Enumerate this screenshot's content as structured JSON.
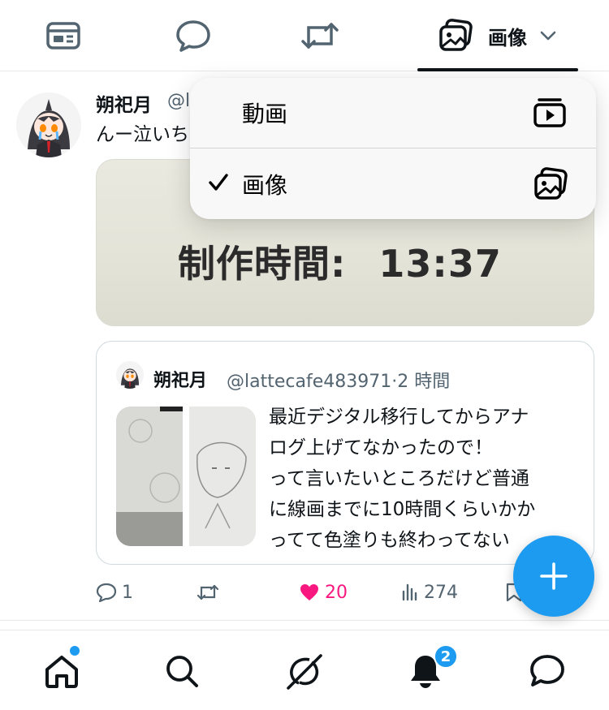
{
  "top_tabs": {
    "tabs": [
      {
        "name": "card-icon",
        "label": ""
      },
      {
        "name": "reply-icon",
        "label": ""
      },
      {
        "name": "repost-icon",
        "label": ""
      },
      {
        "name": "media-icon",
        "label": "画像"
      }
    ],
    "selected_tab_label": "画像"
  },
  "tweet": {
    "author_name": "朔祀月",
    "author_handle": "@l",
    "text": "んー泣いち",
    "media_caption_label": "制作時間:",
    "media_caption_time": "13:37",
    "quote": {
      "author_name": "朔祀月",
      "author_handle": "@lattecafe483971",
      "time_separator": "·",
      "time": "2 時間",
      "text_lines": [
        "最近デジタル移行してからアナ",
        "ログ上げてなかったので！",
        "って言いたいところだけど普通",
        "に線画までに10時間くらいかか",
        "ってて色塗りも終わってない"
      ]
    },
    "actions": {
      "reply_count": "1",
      "repost_count": "",
      "like_count": "20",
      "view_count": "274"
    },
    "colors": {
      "like_active": "#f91880",
      "muted": "#536471"
    }
  },
  "dropdown": {
    "items": [
      {
        "label": "動画",
        "icon": "video-icon",
        "checked": false
      },
      {
        "label": "画像",
        "icon": "image-icon",
        "checked": true
      }
    ],
    "check_mark": "✓"
  },
  "fab": {
    "icon": "plus-icon",
    "color": "#1d9bf0"
  },
  "bottom_nav": {
    "items": [
      "home-icon",
      "search-icon",
      "grok-icon",
      "notifications-icon",
      "messages-icon"
    ],
    "notifications_badge": "2",
    "accent": "#1d9bf0"
  }
}
